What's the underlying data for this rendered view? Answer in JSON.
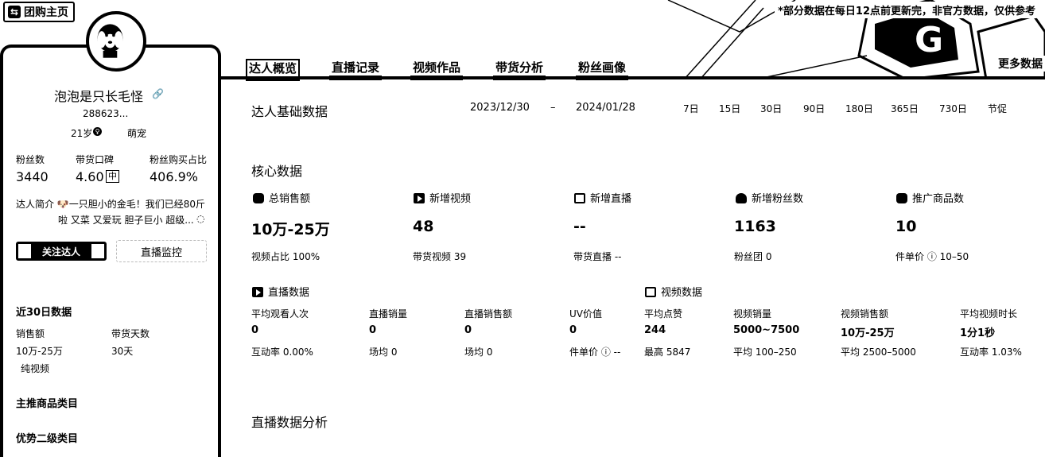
{
  "header": {
    "back_label": "团购主页",
    "notice": "*部分数据在每日12点前更新完，非官方数据，仅供参考",
    "more_label": "更多数据"
  },
  "tabs": [
    {
      "label": "达人概览",
      "active": true
    },
    {
      "label": "直播记录",
      "active": false
    },
    {
      "label": "视频作品",
      "active": false
    },
    {
      "label": "带货分析",
      "active": false
    },
    {
      "label": "粉丝画像",
      "active": false
    }
  ],
  "profile": {
    "name": "泡泡是只长毛怪",
    "id": "288623...",
    "age": "21岁",
    "category": "萌宠",
    "stats": [
      {
        "label": "粉丝数",
        "value": "3440"
      },
      {
        "label": "带货口碑",
        "value": "4.60",
        "badge": "中"
      },
      {
        "label": "粉丝购买占比",
        "value": "406.9%"
      }
    ],
    "bio_line1": "达人简介 🐶一只胆小的金毛！我们已经80斤",
    "bio_line2": "啦 又菜 又爱玩 胆子巨小 超级...",
    "follow_label": "关注达人",
    "monitor_label": "直播监控"
  },
  "recent30": {
    "title": "近30日数据",
    "sales_label": "销售额",
    "sales_value": "10万-25万",
    "sales_note": "纯视频",
    "days_label": "带货天数",
    "days_value": "30天"
  },
  "sidebar_sections": [
    "主推商品类目",
    "优势二级类目"
  ],
  "basic": {
    "title": "达人基础数据",
    "date_start": "2023/12/30",
    "date_sep": "–",
    "date_end": "2024/01/28",
    "ranges": [
      "7日",
      "15日",
      "30日",
      "90日",
      "180日",
      "365日",
      "730日",
      "节促"
    ]
  },
  "core": {
    "title": "核心数据",
    "cards": [
      {
        "label": "总销售额",
        "value": "10万-25万",
        "sub": "视频占比 100%",
        "icon": "sales-icon"
      },
      {
        "label": "新增视频",
        "value": "48",
        "sub": "带货视频 39",
        "icon": "video-icon"
      },
      {
        "label": "新增直播",
        "value": "--",
        "sub": "带货直播 --",
        "icon": "live-icon"
      },
      {
        "label": "新增粉丝数",
        "value": "1163",
        "sub": "粉丝团 0",
        "icon": "fans-icon"
      },
      {
        "label": "推广商品数",
        "value": "10",
        "sub": "件单价 ⓘ 10–50",
        "icon": "product-icon"
      }
    ]
  },
  "live": {
    "title": "直播数据",
    "metrics": [
      {
        "label": "平均观看人次",
        "value": "0",
        "sub": "互动率 0.00%"
      },
      {
        "label": "直播销量",
        "value": "0",
        "sub": "场均 0"
      },
      {
        "label": "直播销售额",
        "value": "0",
        "sub": "场均 0"
      },
      {
        "label": "UV价值",
        "value": "0",
        "sub": "件单价 ⓘ --"
      }
    ]
  },
  "video": {
    "title": "视频数据",
    "metrics": [
      {
        "label": "平均点赞",
        "value": "244",
        "sub": "最高 5847"
      },
      {
        "label": "视频销量",
        "value": "5000~7500",
        "sub": "平均 100–250"
      },
      {
        "label": "视频销售额",
        "value": "10万-25万",
        "sub": "平均 2500–5000"
      },
      {
        "label": "平均视频时长",
        "value": "1分1秒",
        "sub": "互动率 1.03%"
      }
    ]
  },
  "live_analysis_title": "直播数据分析"
}
